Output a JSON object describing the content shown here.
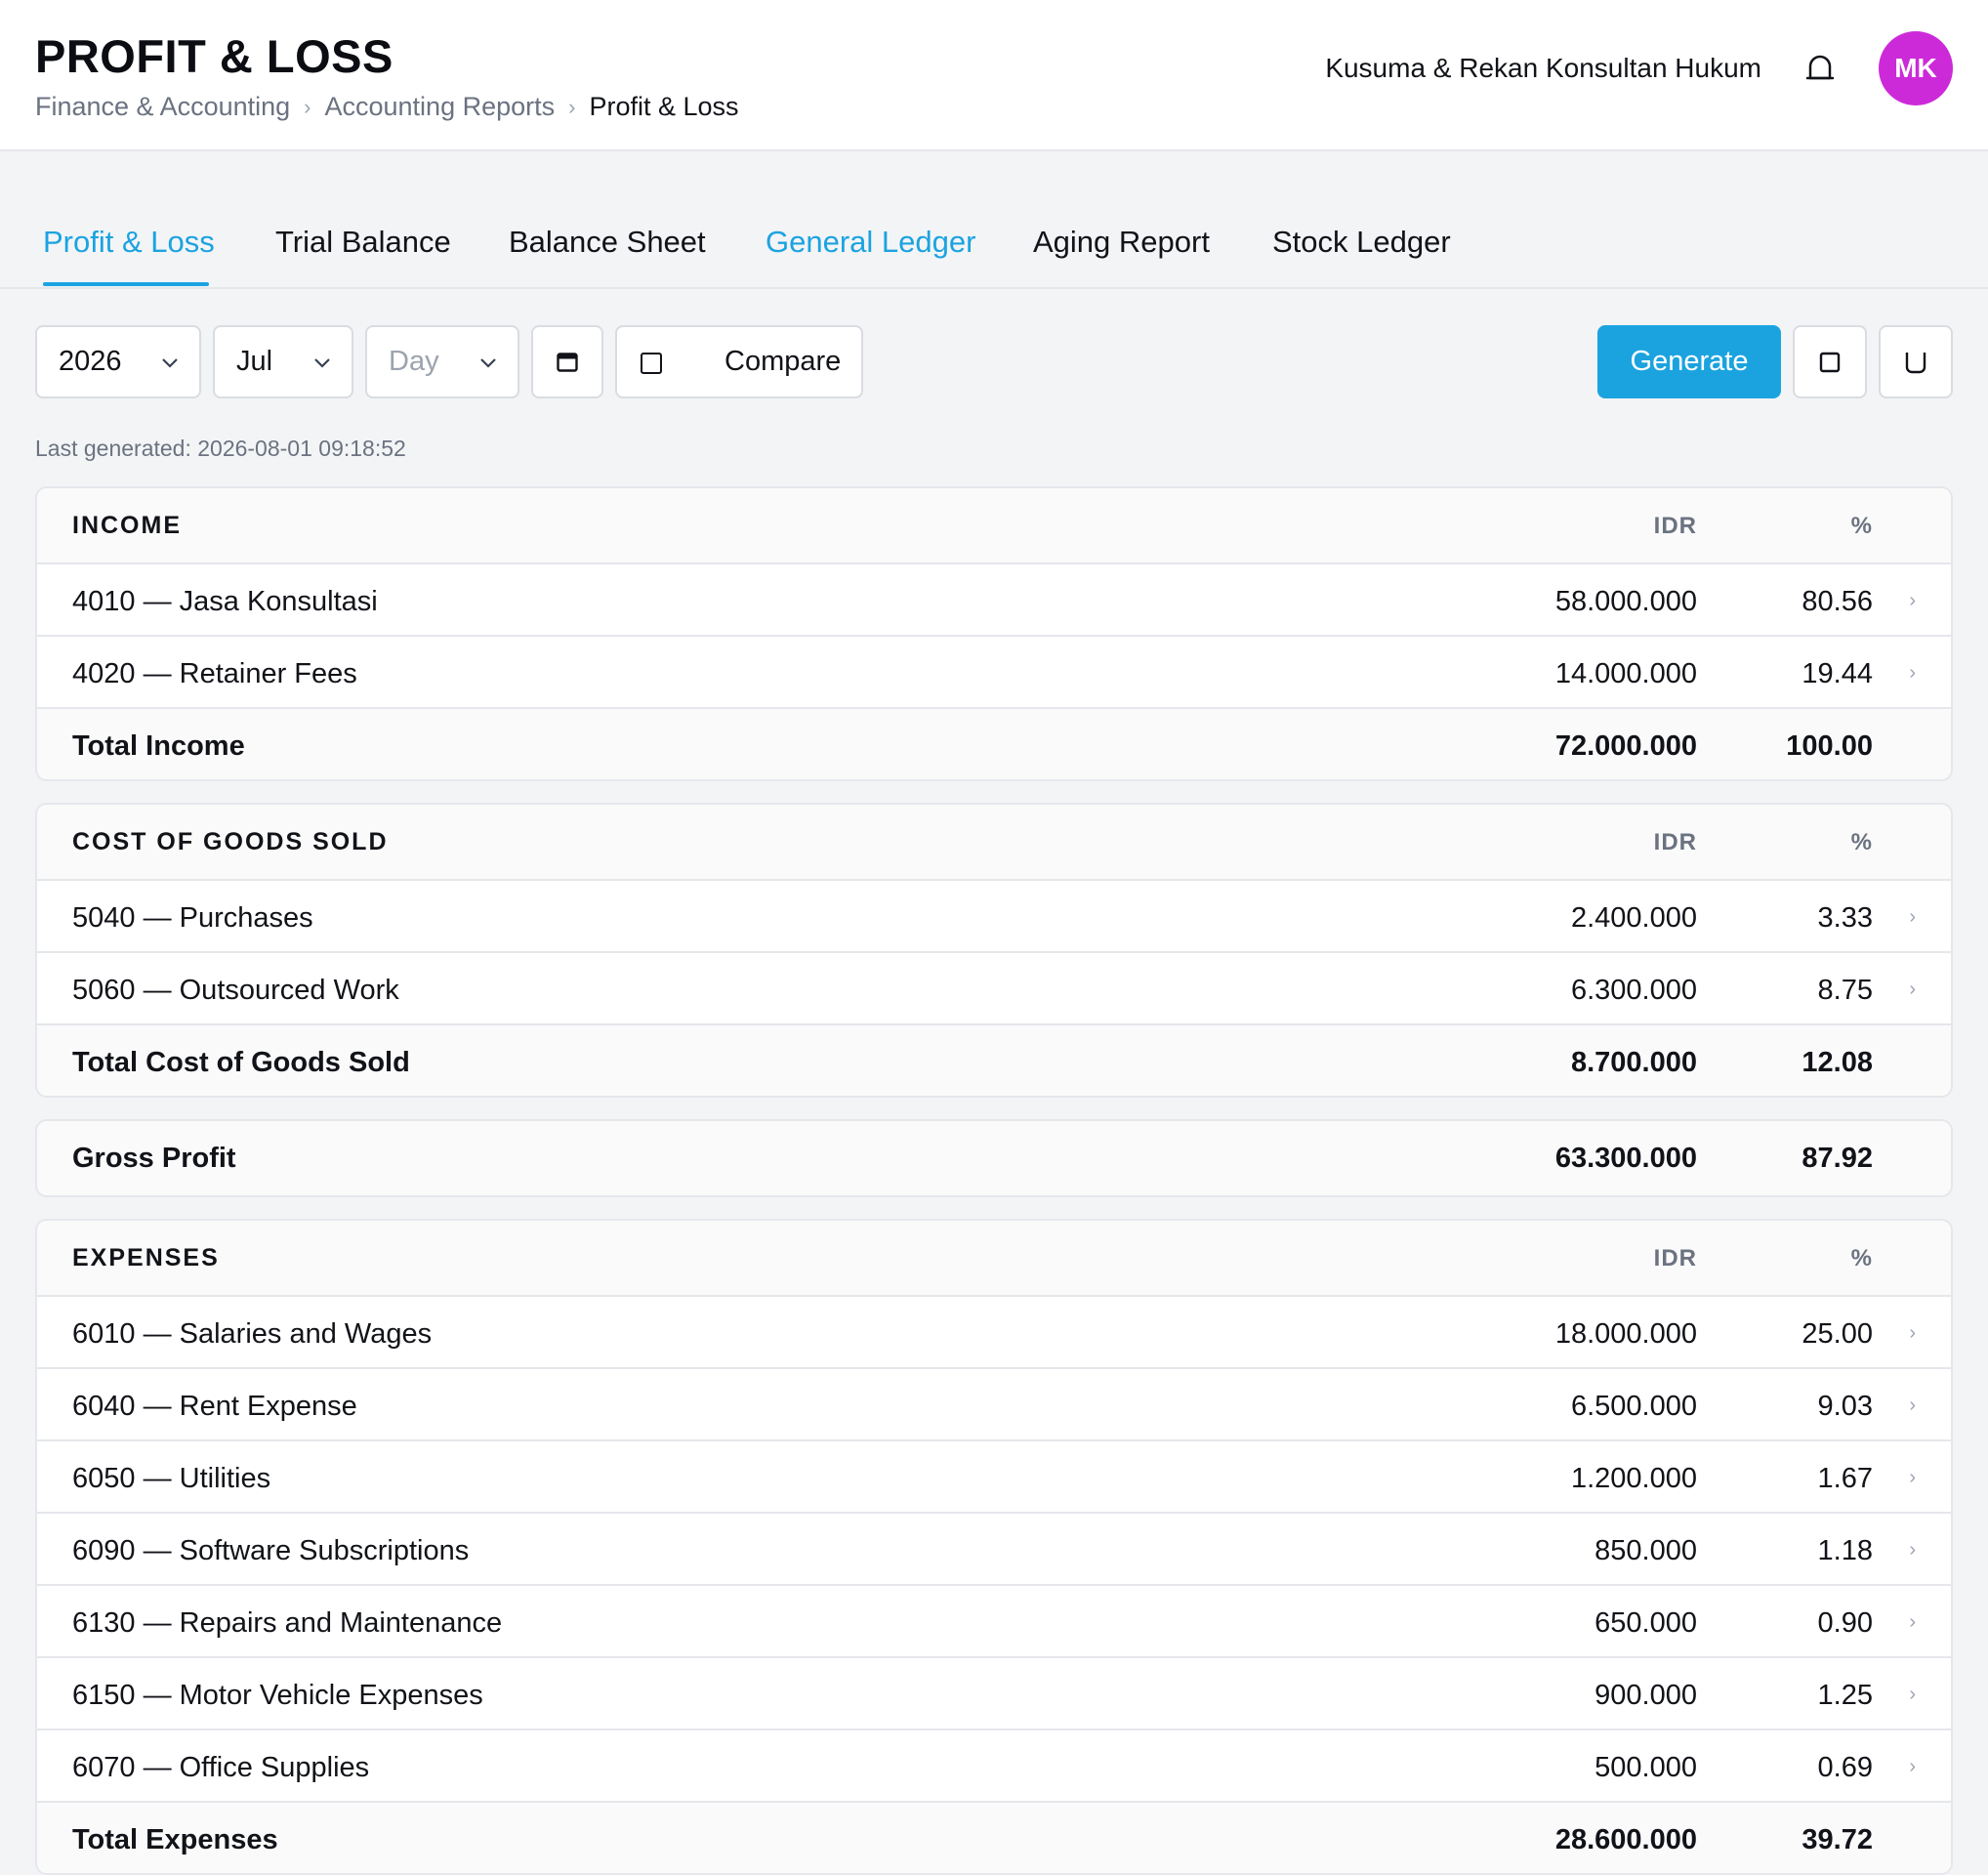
{
  "header": {
    "title": "PROFIT & LOSS",
    "breadcrumb": [
      "Finance & Accounting",
      "Accounting Reports",
      "Profit & Loss"
    ],
    "company": "Kusuma & Rekan Konsultan Hukum",
    "avatar_initials": "MK",
    "avatar_color": "#cc2ad8",
    "bell_icon": "bell-icon"
  },
  "tabs": [
    {
      "label": "Profit & Loss",
      "state": "active"
    },
    {
      "label": "Trial Balance",
      "state": "normal"
    },
    {
      "label": "Balance Sheet",
      "state": "normal"
    },
    {
      "label": "General Ledger",
      "state": "link"
    },
    {
      "label": "Aging Report",
      "state": "normal"
    },
    {
      "label": "Stock Ledger",
      "state": "normal"
    }
  ],
  "toolbar": {
    "year": "2026",
    "month": "Jul",
    "day_placeholder": "Day",
    "calendar_icon": "calendar-icon",
    "compare_label": "Compare",
    "compare_checked": false,
    "generate_label": "Generate",
    "accent_color": "#1ba3e0",
    "extra_icons": [
      "square-icon",
      "cup-icon"
    ]
  },
  "last_generated": "Last generated: 2026-08-01 09:18:52",
  "sections": {
    "income": {
      "heading": "INCOME",
      "col_amount": "IDR",
      "col_pct": "%",
      "rows": [
        {
          "name": "4010 — Jasa Konsultasi",
          "amount": "58.000.000",
          "pct": "80.56"
        },
        {
          "name": "4020 — Retainer Fees",
          "amount": "14.000.000",
          "pct": "19.44"
        }
      ],
      "total": {
        "name": "Total Income",
        "amount": "72.000.000",
        "pct": "100.00"
      }
    },
    "cogs": {
      "heading": "COST OF GOODS SOLD",
      "col_amount": "IDR",
      "col_pct": "%",
      "rows": [
        {
          "name": "5040 — Purchases",
          "amount": "2.400.000",
          "pct": "3.33"
        },
        {
          "name": "5060 — Outsourced Work",
          "amount": "6.300.000",
          "pct": "8.75"
        }
      ],
      "total": {
        "name": "Total Cost of Goods Sold",
        "amount": "8.700.000",
        "pct": "12.08"
      }
    },
    "gross_profit": {
      "name": "Gross Profit",
      "amount": "63.300.000",
      "pct": "87.92"
    },
    "expenses": {
      "heading": "EXPENSES",
      "col_amount": "IDR",
      "col_pct": "%",
      "rows": [
        {
          "name": "6010 — Salaries and Wages",
          "amount": "18.000.000",
          "pct": "25.00"
        },
        {
          "name": "6040 — Rent Expense",
          "amount": "6.500.000",
          "pct": "9.03"
        },
        {
          "name": "6050 — Utilities",
          "amount": "1.200.000",
          "pct": "1.67"
        },
        {
          "name": "6090 — Software Subscriptions",
          "amount": "850.000",
          "pct": "1.18"
        },
        {
          "name": "6130 — Repairs and Maintenance",
          "amount": "650.000",
          "pct": "0.90"
        },
        {
          "name": "6150 — Motor Vehicle Expenses",
          "amount": "900.000",
          "pct": "1.25"
        },
        {
          "name": "6070 — Office Supplies",
          "amount": "500.000",
          "pct": "0.69"
        }
      ],
      "total": {
        "name": "Total Expenses",
        "amount": "28.600.000",
        "pct": "39.72"
      }
    }
  },
  "row_arrow": "›"
}
